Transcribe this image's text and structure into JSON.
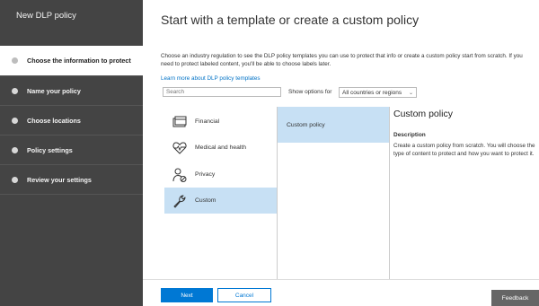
{
  "sidebar": {
    "title": "New DLP policy",
    "steps": [
      {
        "label": "Choose the information to protect",
        "active": true
      },
      {
        "label": "Name your policy",
        "active": false
      },
      {
        "label": "Choose locations",
        "active": false
      },
      {
        "label": "Policy settings",
        "active": false
      },
      {
        "label": "Review your settings",
        "active": false
      }
    ]
  },
  "main": {
    "heading": "Start with a template or create a custom policy",
    "description": "Choose an industry regulation to see the DLP policy templates you can use to protect that info or create a custom policy start from scratch. If you need to protect labeled content, you'll be able to choose labels later.",
    "learn_link": "Learn more about DLP policy templates",
    "search": {
      "placeholder": "Search"
    },
    "show_options_label": "Show options for",
    "region_select": {
      "value": "All countries or regions"
    },
    "categories": [
      {
        "label": "Financial",
        "icon": "financial-card-icon",
        "selected": false
      },
      {
        "label": "Medical and health",
        "icon": "heart-pulse-icon",
        "selected": false
      },
      {
        "label": "Privacy",
        "icon": "privacy-person-icon",
        "selected": false
      },
      {
        "label": "Custom",
        "icon": "wrench-icon",
        "selected": true
      }
    ],
    "templates": [
      {
        "label": "Custom policy",
        "selected": true
      }
    ],
    "detail": {
      "title": "Custom policy",
      "subtitle": "Description",
      "text": "Create a custom policy from scratch. You will choose the type of content to protect and how you want to protect it."
    }
  },
  "footer": {
    "next_label": "Next",
    "cancel_label": "Cancel",
    "feedback_label": "Feedback"
  },
  "colors": {
    "sidebar_bg": "#444444",
    "accent": "#0078d4",
    "selection": "#c7e0f4"
  }
}
